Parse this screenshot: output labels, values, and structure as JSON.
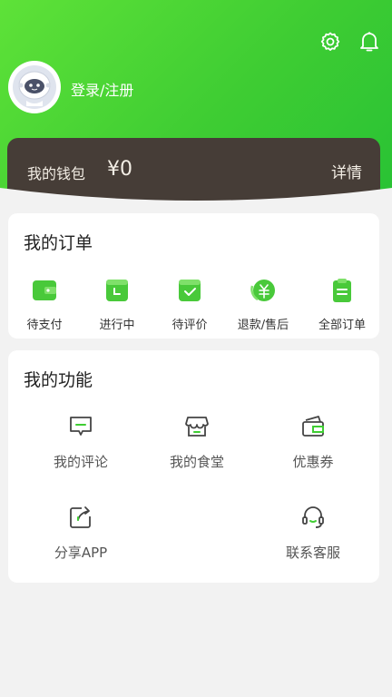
{
  "header": {
    "settings_icon": "gear-icon",
    "notification_icon": "bell-icon",
    "login_label": "登录/注册",
    "avatar_icon": "robot-avatar-icon"
  },
  "wallet": {
    "label": "我的钱包",
    "amount": "¥0",
    "detail_label": "详情",
    "background": "#463d37"
  },
  "orders": {
    "title": "我的订单",
    "items": [
      {
        "label": "待支付",
        "icon": "wallet-icon"
      },
      {
        "label": "进行中",
        "icon": "clock-icon"
      },
      {
        "label": "待评价",
        "icon": "check-box-icon"
      },
      {
        "label": "退款/售后",
        "icon": "yuan-refund-icon"
      },
      {
        "label": "全部订单",
        "icon": "clipboard-icon"
      }
    ]
  },
  "functions": {
    "title": "我的功能",
    "items": [
      {
        "label": "我的评论",
        "icon": "comment-icon"
      },
      {
        "label": "我的食堂",
        "icon": "store-icon"
      },
      {
        "label": "优惠券",
        "icon": "coupon-icon"
      },
      {
        "label": "分享APP",
        "icon": "share-icon"
      },
      {
        "label": "联系客服",
        "icon": "headset-icon"
      }
    ]
  },
  "colors": {
    "brand_green": "#3fcd33",
    "accent_green": "#43c83a"
  }
}
